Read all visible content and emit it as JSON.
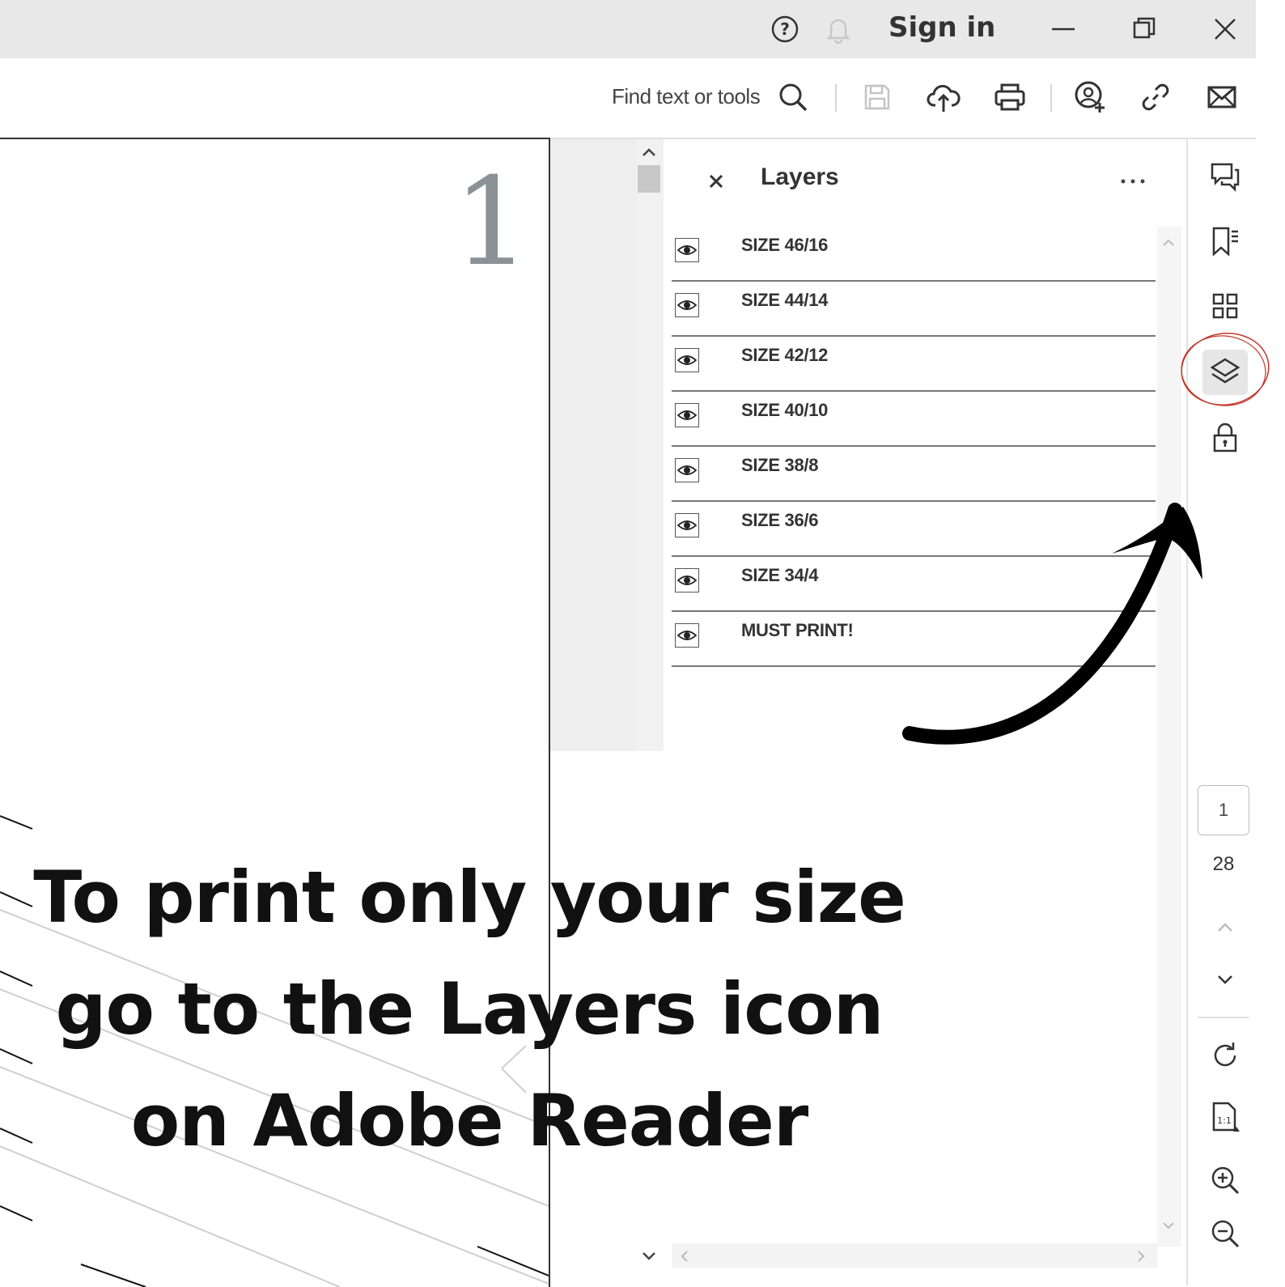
{
  "titlebar": {
    "sign_in": "Sign in"
  },
  "toolbar": {
    "find_placeholder": "Find text or tools"
  },
  "document": {
    "page_number_display": "1"
  },
  "layers_panel": {
    "title": "Layers",
    "layers": [
      {
        "label": "SIZE 46/16"
      },
      {
        "label": "SIZE 44/14"
      },
      {
        "label": "SIZE 42/12"
      },
      {
        "label": "SIZE 40/10"
      },
      {
        "label": "SIZE 38/8"
      },
      {
        "label": "SIZE 36/6"
      },
      {
        "label": "SIZE 34/4"
      },
      {
        "label": "MUST PRINT!"
      }
    ]
  },
  "page_nav": {
    "current_page": "1",
    "total_pages": "28"
  },
  "caption": {
    "line1": "To print only your size",
    "line2": "go to the Layers icon",
    "line3": "on Adobe Reader"
  },
  "colors": {
    "annotation_circle": "#c0392b",
    "arrow": "#000000"
  }
}
